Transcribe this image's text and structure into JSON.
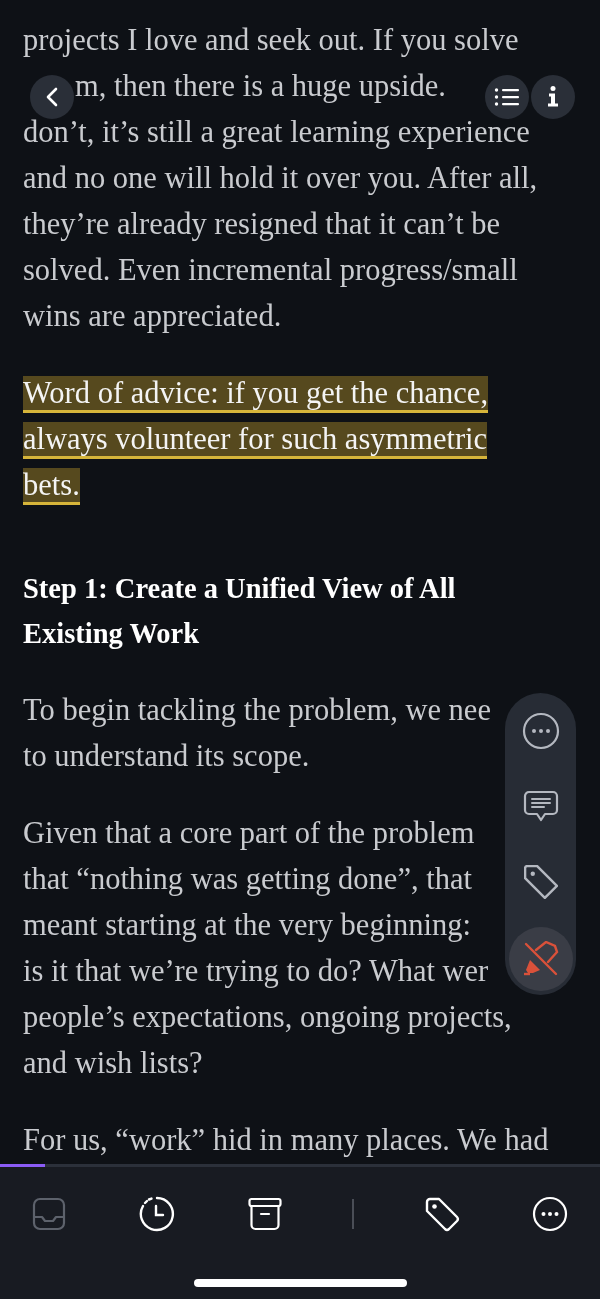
{
  "article": {
    "blocks": [
      {
        "kind": "paragraph",
        "highlighted": false,
        "lines": [
          "projects I love and seek out. If you solve"
        ]
      },
      {
        "kind": "fragment",
        "highlighted": false,
        "lines": [
          "m, then there is a huge upside."
        ]
      },
      {
        "kind": "paragraph",
        "highlighted": false,
        "lines": [
          "don’t, it’s still a great learning experience",
          "and no one will hold it over you. After all,",
          "they’re already resigned that it can’t be",
          "solved. Even incremental progress/small",
          "wins are appreciated."
        ]
      },
      {
        "kind": "paragraph",
        "highlighted": true,
        "lines": [
          "Word of advice: if you get the chance,",
          "always volunteer for such asymmetric",
          "bets."
        ]
      },
      {
        "kind": "heading",
        "lines": [
          "Step 1: Create a Unified View of All",
          "Existing Work"
        ]
      },
      {
        "kind": "paragraph",
        "highlighted": false,
        "lines": [
          "To begin tackling the problem, we nee",
          "to understand its scope."
        ]
      },
      {
        "kind": "paragraph",
        "highlighted": false,
        "lines": [
          "Given that a core part of the problem",
          "that “nothing was getting done”, that",
          "meant starting at the very beginning:",
          "is it that we’re trying to do? What wer",
          "people’s expectations, ongoing projects,",
          "and wish lists?"
        ]
      },
      {
        "kind": "paragraph",
        "highlighted": false,
        "lines": [
          "For us, “work” hid in many places. We had"
        ]
      }
    ]
  },
  "reading_progress": {
    "level": 0.075
  },
  "floating_toolbar": [
    {
      "kind": "more",
      "selected": false
    },
    {
      "kind": "comment",
      "selected": false
    },
    {
      "kind": "tag",
      "selected": false
    },
    {
      "kind": "highlight-off",
      "selected": true
    }
  ],
  "bottom_bar": [
    {
      "kind": "inbox",
      "disabled": true
    },
    {
      "kind": "clock",
      "disabled": false
    },
    {
      "kind": "archive",
      "disabled": false
    },
    {
      "kind": "divider"
    },
    {
      "kind": "tag",
      "disabled": false
    },
    {
      "kind": "more",
      "disabled": false
    }
  ]
}
